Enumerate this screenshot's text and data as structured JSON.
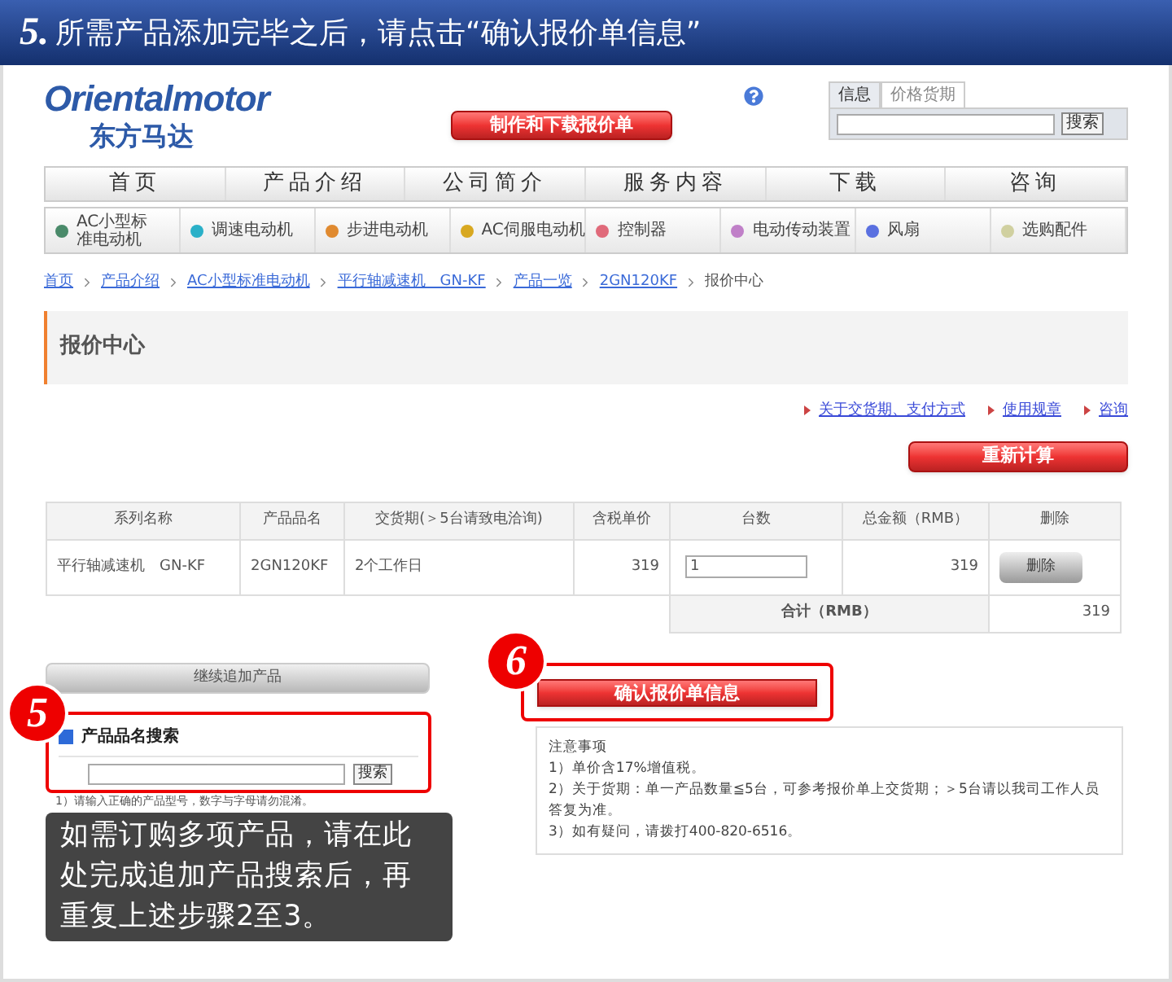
{
  "banner": {
    "step": "5.",
    "title": "所需产品添加完毕之后，请点击“确认报价单信息”"
  },
  "logo": {
    "brand": "Orientalmotor",
    "subtitle": "东方马达"
  },
  "header_button": "制作和下载报价单",
  "search": {
    "tabs": [
      {
        "label": "信息",
        "selected": true
      },
      {
        "label": "价格货期",
        "selected": false
      }
    ],
    "button": "搜索"
  },
  "nav": [
    "首页",
    "产品介绍",
    "公司简介",
    "服务内容",
    "下载",
    "咨询"
  ],
  "subnav": [
    {
      "label": "AC小型标准电动机",
      "color": "#4a8a6a"
    },
    {
      "label": "调速电动机",
      "color": "#2ab0c8"
    },
    {
      "label": "步进电动机",
      "color": "#e08a30"
    },
    {
      "label": "AC伺服电动机",
      "color": "#d8a820"
    },
    {
      "label": "控制器",
      "color": "#e06a7a"
    },
    {
      "label": "电动传动装置",
      "color": "#c080c8"
    },
    {
      "label": "风扇",
      "color": "#5a70e0"
    },
    {
      "label": "选购配件",
      "color": "#d0d0a0"
    }
  ],
  "breadcrumb": {
    "links": [
      "首页",
      "产品介绍",
      "AC小型标准电动机",
      "平行轴减速机　GN-KF",
      "产品一览",
      "2GN120KF"
    ],
    "current": "报价中心"
  },
  "page_title": "报价中心",
  "links": [
    "关于交货期、支付方式",
    "使用规章",
    "咨询"
  ],
  "recalc_button": "重新计算",
  "table": {
    "columns": [
      "系列名称",
      "产品品名",
      "交货期(＞5台请致电洽询)",
      "含税单价",
      "台数",
      "总金额（RMB）",
      "删除"
    ],
    "rows": [
      {
        "series": "平行轴减速机　GN-KF",
        "product": "2GN120KF",
        "delivery": "2个工作日",
        "price": "319",
        "quantity": "1",
        "amount": "319",
        "delete": "删除"
      }
    ],
    "total_label": "合计（RMB）",
    "total": "319"
  },
  "add_button": "继续追加产品",
  "product_search": {
    "step": "5",
    "title": "产品品名搜索",
    "button": "搜索",
    "note": "1）请输入正确的产品型号，数字与字母请勿混淆。"
  },
  "tooltip": "如需订购多项产品，请在此处完成追加产品搜索后，再重复上述步骤2至3。",
  "confirm": {
    "step": "6",
    "button": "确认报价单信息"
  },
  "notes": {
    "title": "注意事项",
    "items": [
      "1）单价含17%增值税。",
      "2）关于货期：单一产品数量≦5台，可参考报价单上交货期；＞5台请以我司工作人员答复为准。",
      "3）如有疑问，请拨打400-820-6516。"
    ]
  }
}
